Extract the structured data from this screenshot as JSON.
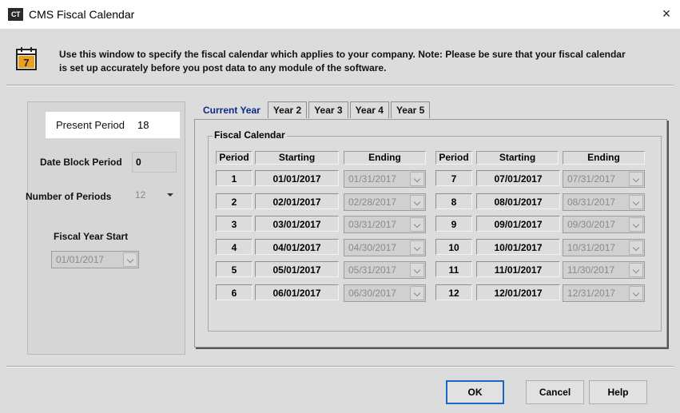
{
  "window": {
    "app_badge": "CT",
    "title": "CMS Fiscal Calendar",
    "close_label": "×"
  },
  "info": {
    "icon_day": "7",
    "line1": "Use this window to specify the fiscal calendar which applies to your company. Note: Please be sure that your fiscal calendar",
    "line2": "is set up accurately before you post data to any module of the software."
  },
  "left": {
    "present_period_label": "Present Period",
    "present_period_value": "18",
    "date_block_label": "Date Block Period",
    "date_block_value": "0",
    "num_periods_label": "Number of Periods",
    "num_periods_value": "12",
    "fiscal_start_label": "Fiscal Year Start",
    "fiscal_start_value": "01/01/2017"
  },
  "tabs": [
    {
      "label": "Current Year"
    },
    {
      "label": "Year 2"
    },
    {
      "label": "Year 3"
    },
    {
      "label": "Year 4"
    },
    {
      "label": "Year 5"
    }
  ],
  "fiscal": {
    "group_label": "Fiscal Calendar",
    "headers": {
      "period": "Period",
      "starting": "Starting",
      "ending": "Ending"
    },
    "rows": [
      {
        "period": "1",
        "start": "01/01/2017",
        "end": "01/31/2017"
      },
      {
        "period": "2",
        "start": "02/01/2017",
        "end": "02/28/2017"
      },
      {
        "period": "3",
        "start": "03/01/2017",
        "end": "03/31/2017"
      },
      {
        "period": "4",
        "start": "04/01/2017",
        "end": "04/30/2017"
      },
      {
        "period": "5",
        "start": "05/01/2017",
        "end": "05/31/2017"
      },
      {
        "period": "6",
        "start": "06/01/2017",
        "end": "06/30/2017"
      },
      {
        "period": "7",
        "start": "07/01/2017",
        "end": "07/31/2017"
      },
      {
        "period": "8",
        "start": "08/01/2017",
        "end": "08/31/2017"
      },
      {
        "period": "9",
        "start": "09/01/2017",
        "end": "09/30/2017"
      },
      {
        "period": "10",
        "start": "10/01/2017",
        "end": "10/31/2017"
      },
      {
        "period": "11",
        "start": "11/01/2017",
        "end": "11/30/2017"
      },
      {
        "period": "12",
        "start": "12/01/2017",
        "end": "12/31/2017"
      }
    ]
  },
  "buttons": {
    "ok": "OK",
    "cancel": "Cancel",
    "help": "Help"
  },
  "colors": {
    "accent": "#1a66c6",
    "active_tab": "#0b2a86",
    "window_bg": "#dcdcdc",
    "calendar_icon": "#e8a020"
  }
}
